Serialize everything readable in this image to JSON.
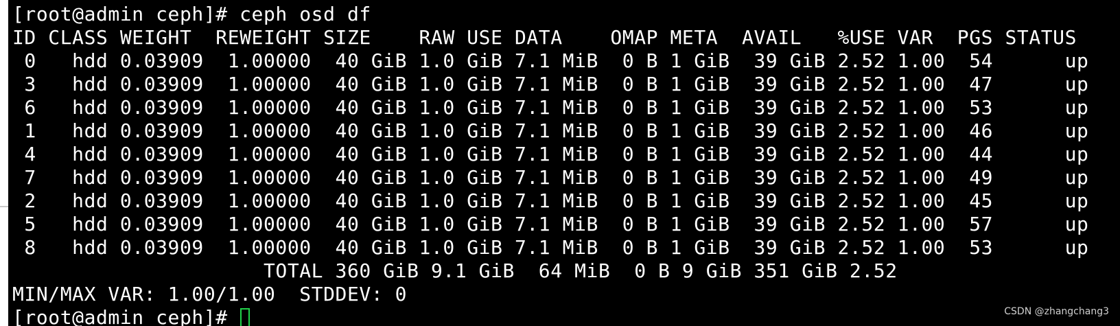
{
  "terminal": {
    "command_prompt": "[root@admin ceph]# ceph osd df",
    "header": "ID CLASS WEIGHT  REWEIGHT SIZE    RAW USE DATA    OMAP META  AVAIL   %USE VAR  PGS STATUS",
    "rows": [
      " 0   hdd 0.03909  1.00000  40 GiB 1.0 GiB 7.1 MiB  0 B 1 GiB  39 GiB 2.52 1.00  54      up",
      " 3   hdd 0.03909  1.00000  40 GiB 1.0 GiB 7.1 MiB  0 B 1 GiB  39 GiB 2.52 1.00  47      up",
      " 6   hdd 0.03909  1.00000  40 GiB 1.0 GiB 7.1 MiB  0 B 1 GiB  39 GiB 2.52 1.00  53      up",
      " 1   hdd 0.03909  1.00000  40 GiB 1.0 GiB 7.1 MiB  0 B 1 GiB  39 GiB 2.52 1.00  46      up",
      " 4   hdd 0.03909  1.00000  40 GiB 1.0 GiB 7.1 MiB  0 B 1 GiB  39 GiB 2.52 1.00  44      up",
      " 7   hdd 0.03909  1.00000  40 GiB 1.0 GiB 7.1 MiB  0 B 1 GiB  39 GiB 2.52 1.00  49      up",
      " 2   hdd 0.03909  1.00000  40 GiB 1.0 GiB 7.1 MiB  0 B 1 GiB  39 GiB 2.52 1.00  45      up",
      " 5   hdd 0.03909  1.00000  40 GiB 1.0 GiB 7.1 MiB  0 B 1 GiB  39 GiB 2.52 1.00  57      up",
      " 8   hdd 0.03909  1.00000  40 GiB 1.0 GiB 7.1 MiB  0 B 1 GiB  39 GiB 2.52 1.00  53      up"
    ],
    "total_line": "                     TOTAL 360 GiB 9.1 GiB  64 MiB  0 B 9 GiB 351 GiB 2.52",
    "summary_line": "MIN/MAX VAR: 1.00/1.00  STDDEV: 0",
    "final_prompt": "[root@admin ceph]# ",
    "cursor_color": "#21d34a",
    "background_color": "#000000",
    "text_color": "#ffffff"
  },
  "watermark": "CSDN @zhangchang3"
}
